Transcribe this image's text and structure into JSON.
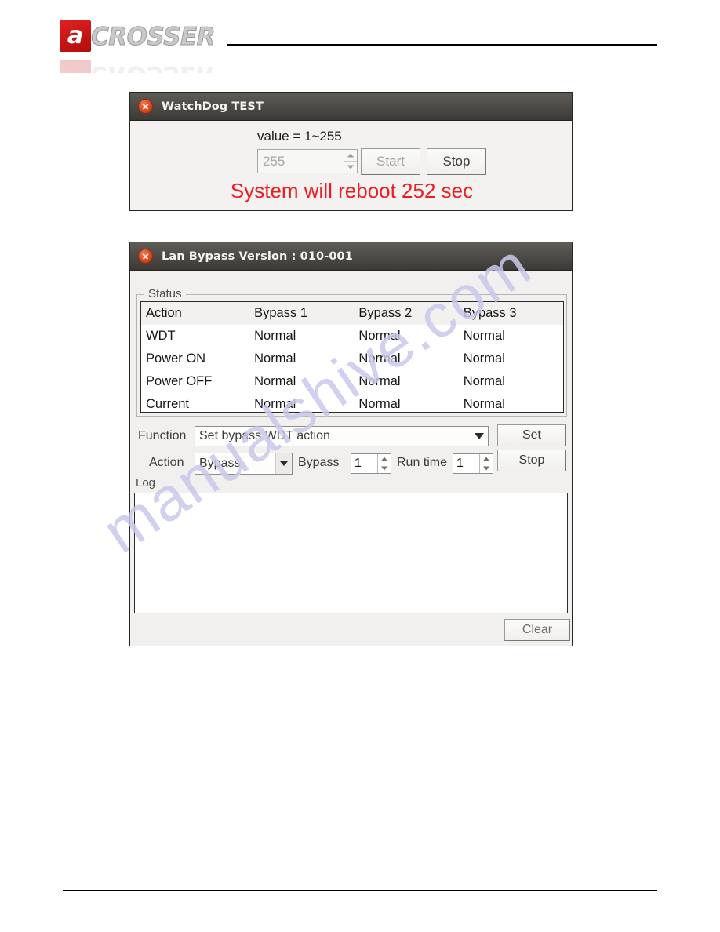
{
  "header": {
    "logo_mark": "a",
    "logo_word": "CROSSER"
  },
  "watchdog_dialog": {
    "title": "WatchDog TEST",
    "close_icon": "close-circle-icon",
    "range_label": "value = 1~255",
    "value_input": "255",
    "start_label": "Start",
    "stop_label": "Stop",
    "status_message": "System will reboot 252 sec",
    "message_color": "#ed1c24"
  },
  "lanbypass_dialog": {
    "title": "Lan Bypass Version : 010-001",
    "close_icon": "close-circle-icon",
    "status_group_label": "Status",
    "status_table": {
      "columns": [
        "Action",
        "Bypass 1",
        "Bypass 2",
        "Bypass 3"
      ],
      "rows": [
        [
          "WDT",
          "Normal",
          "Normal",
          "Normal"
        ],
        [
          "Power ON",
          "Normal",
          "Normal",
          "Normal"
        ],
        [
          "Power OFF",
          "Normal",
          "Normal",
          "Normal"
        ],
        [
          "Current",
          "Normal",
          "Normal",
          "Normal"
        ]
      ]
    },
    "function_label": "Function",
    "function_value": "Set bypass WDT action",
    "set_label": "Set",
    "action_label": "Action",
    "action_value": "Bypass",
    "bypass_label": "Bypass",
    "bypass_value": "1",
    "runtime_label": "Run time",
    "runtime_value": "1",
    "stop_label": "Stop",
    "log_group_label": "Log",
    "log_content": "",
    "clear_label": "Clear"
  },
  "watermark": {
    "text": "manualshive.com",
    "color": "#c9c8ec"
  }
}
